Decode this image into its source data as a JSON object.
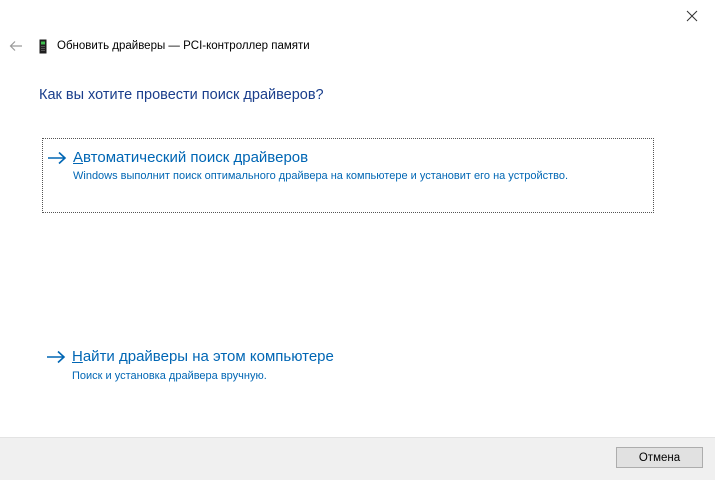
{
  "window": {
    "title": "Обновить драйверы — PCI-контроллер памяти",
    "title_icon": "device-chip-icon",
    "close_icon": "close-icon",
    "back_icon": "back-arrow-icon"
  },
  "main": {
    "heading": "Как вы хотите провести поиск драйверов?",
    "options": [
      {
        "title_underlined": "А",
        "title_rest": "втоматический поиск драйверов",
        "description": "Windows выполнит поиск оптимального драйвера на компьютере и установит его на устройство.",
        "icon": "right-arrow-icon",
        "focused": true
      },
      {
        "title_underlined": "Н",
        "title_rest": "айти драйверы на этом компьютере",
        "description": "Поиск и установка драйвера вручную.",
        "icon": "right-arrow-icon",
        "focused": false
      }
    ]
  },
  "footer": {
    "cancel_label": "Отмена"
  },
  "colors": {
    "heading": "#1a3e8c",
    "link": "#0066b4",
    "footer_bg": "#f0f0f0"
  }
}
